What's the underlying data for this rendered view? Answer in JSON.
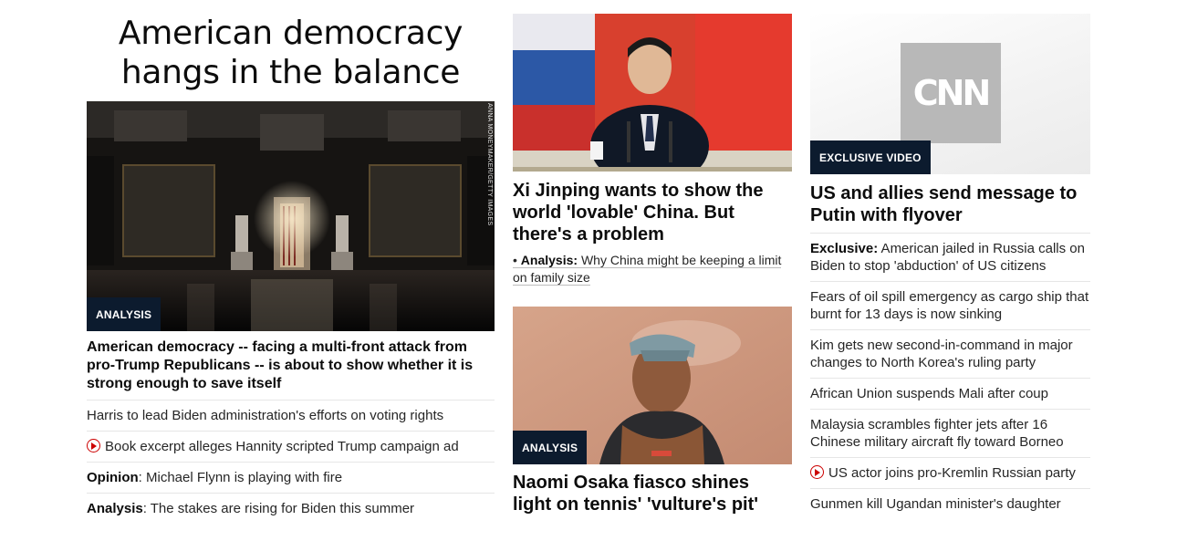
{
  "col1": {
    "headline": "American democracy hangs in the balance",
    "image_credit": "ANNA MONEYMAKER/GETTY IMAGES",
    "badge": "ANALYSIS",
    "lead_title": "American democracy -- facing a multi-front attack from pro-Trump Republicans -- is about to show whether it is strong enough to save itself",
    "items": [
      {
        "prefix": "",
        "text": "Harris to lead Biden administration's efforts on voting rights"
      },
      {
        "prefix": "",
        "text": "Book excerpt alleges Hannity scripted Trump campaign ad",
        "video": true
      },
      {
        "prefix": "Opinion",
        "text": ": Michael Flynn is playing with fire"
      },
      {
        "prefix": "Analysis",
        "text": ": The stakes are rising for Biden this summer"
      }
    ]
  },
  "col2": {
    "story1_title": "Xi Jinping wants to show the world 'lovable' China. But there's a problem",
    "story1_sub_bullet": "•",
    "story1_sub_label": "Analysis:",
    "story1_sub_text": "Why China might be keeping a limit on family size",
    "story2_badge": "ANALYSIS",
    "story2_title": "Naomi Osaka fiasco shines light on tennis' 'vulture's pit'"
  },
  "col3": {
    "logo_text": "CNN",
    "badge": "EXCLUSIVE VIDEO",
    "lead_title": "US and allies send message to Putin with flyover",
    "items": [
      {
        "prefix": "Exclusive:",
        "text": " American jailed in Russia calls on Biden to stop 'abduction' of US citizens"
      },
      {
        "prefix": "",
        "text": "Fears of oil spill emergency as cargo ship that burnt for 13 days is now sinking"
      },
      {
        "prefix": "",
        "text": "Kim gets new second-in-command in major changes to North Korea's ruling party"
      },
      {
        "prefix": "",
        "text": "African Union suspends Mali after coup"
      },
      {
        "prefix": "",
        "text": "Malaysia scrambles fighter jets after 16 Chinese military aircraft fly toward Borneo"
      },
      {
        "prefix": "",
        "text": "US actor joins pro-Kremlin Russian party",
        "video": true
      },
      {
        "prefix": "",
        "text": "Gunmen kill Ugandan minister's daughter"
      }
    ]
  },
  "colors": {
    "badge_bg": "#0c1b2e",
    "video_icon": "#cc0000",
    "divider": "#e6e6e6"
  }
}
